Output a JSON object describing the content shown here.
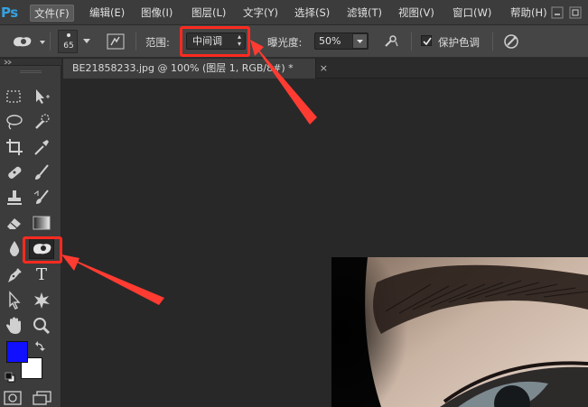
{
  "app": {
    "logo": "Ps"
  },
  "menu": [
    {
      "label": "文件(F)",
      "active": true
    },
    {
      "label": "编辑(E)"
    },
    {
      "label": "图像(I)"
    },
    {
      "label": "图层(L)"
    },
    {
      "label": "文字(Y)"
    },
    {
      "label": "选择(S)"
    },
    {
      "label": "滤镜(T)"
    },
    {
      "label": "视图(V)"
    },
    {
      "label": "窗口(W)"
    },
    {
      "label": "帮助(H)"
    }
  ],
  "options": {
    "brush_size": "65",
    "range_label": "范围:",
    "range_value": "中间调",
    "exposure_label": "曝光度:",
    "exposure_value": "50%",
    "protect_label": "保护色调",
    "protect_checked": true
  },
  "document": {
    "tab_title": "BE21858233.jpg @ 100% (图层 1, RGB/8#) *",
    "close_glyph": "×"
  },
  "colors": {
    "foreground": "#1010ff",
    "background": "#ffffff",
    "annotation": "#ff2a20",
    "accent_logo": "#35a2e2"
  },
  "tools": [
    {
      "name": "rectangular-marquee-icon"
    },
    {
      "name": "move-icon"
    },
    {
      "name": "lasso-icon"
    },
    {
      "name": "quick-selection-icon"
    },
    {
      "name": "crop-icon"
    },
    {
      "name": "eyedropper-icon"
    },
    {
      "name": "spot-healing-icon"
    },
    {
      "name": "brush-icon"
    },
    {
      "name": "clone-stamp-icon"
    },
    {
      "name": "history-brush-icon"
    },
    {
      "name": "eraser-icon"
    },
    {
      "name": "gradient-icon"
    },
    {
      "name": "blur-icon"
    },
    {
      "name": "sponge-dodge-icon",
      "selected": true
    },
    {
      "name": "pen-icon"
    },
    {
      "name": "type-icon",
      "glyph": "T"
    },
    {
      "name": "path-selection-icon"
    },
    {
      "name": "shape-icon"
    },
    {
      "name": "hand-icon"
    },
    {
      "name": "zoom-icon"
    }
  ]
}
